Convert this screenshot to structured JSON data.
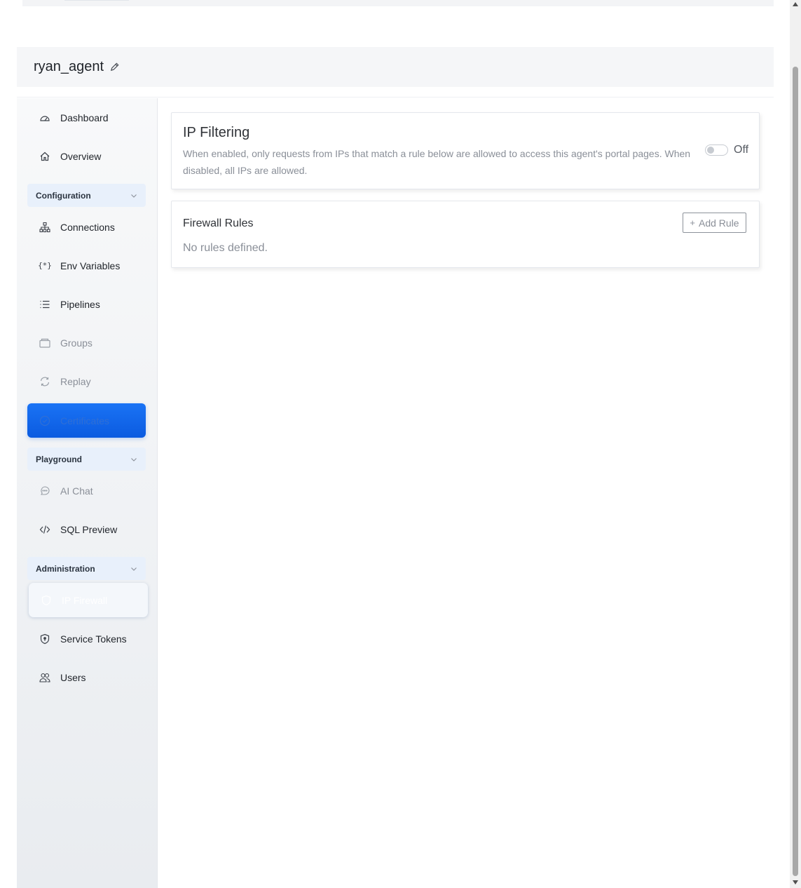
{
  "header": {
    "agent_name": "ryan_agent"
  },
  "sidebar": {
    "items": [
      {
        "label": "Dashboard",
        "icon": "dashboard-gauge-icon"
      },
      {
        "label": "Overview",
        "icon": "home-icon"
      },
      {
        "section": "Configuration"
      },
      {
        "label": "Connections",
        "icon": "network-icon"
      },
      {
        "label": "Env Variables",
        "icon": "braces-icon"
      },
      {
        "label": "Pipelines",
        "icon": "list-icon"
      },
      {
        "label": "Groups",
        "icon": "folder-icon"
      },
      {
        "label": "Replay",
        "icon": "refresh-icon"
      },
      {
        "label": "Certificates",
        "icon": "certificate-icon"
      },
      {
        "section": "Playground"
      },
      {
        "label": "AI Chat",
        "icon": "chat-icon"
      },
      {
        "label": "SQL Preview",
        "icon": "code-icon"
      },
      {
        "section": "Administration"
      },
      {
        "label": "IP Firewall",
        "icon": "shield-icon"
      },
      {
        "label": "Service Tokens",
        "icon": "shield-key-icon"
      },
      {
        "label": "Users",
        "icon": "users-icon"
      }
    ]
  },
  "ip_filtering": {
    "title": "IP Filtering",
    "description": "When enabled, only requests from IPs that match a rule below are allowed to access this agent's portal pages. When disabled, all IPs are allowed.",
    "toggle_state": "Off"
  },
  "firewall_rules": {
    "title": "Firewall Rules",
    "add_button": "Add Rule",
    "empty_text": "No rules defined."
  },
  "colors": {
    "accent_blue": "#1268eb",
    "section_bg": "#e8f0fb"
  }
}
